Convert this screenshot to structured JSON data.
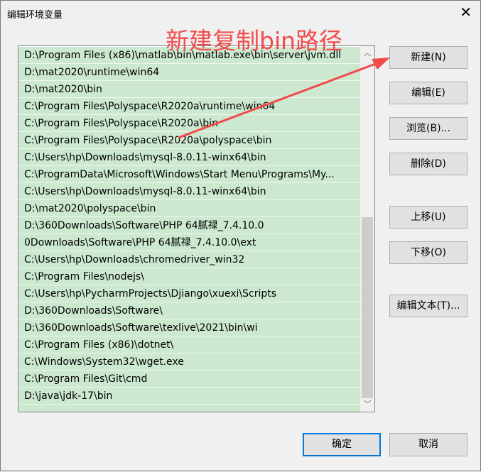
{
  "window": {
    "title": "编辑环境变量",
    "close_icon": "close-icon"
  },
  "annotation": {
    "text": "新建复制bin路径",
    "color": "#f24b4b"
  },
  "list": {
    "items": [
      "D:\\Program Files (x86)\\matlab\\bin\\matlab.exe\\bin\\server\\jvm.dll",
      "D:\\mat2020\\runtime\\win64",
      "D:\\mat2020\\bin",
      "C:\\Program Files\\Polyspace\\R2020a\\runtime\\win64",
      "C:\\Program Files\\Polyspace\\R2020a\\bin",
      "C:\\Program Files\\Polyspace\\R2020a\\polyspace\\bin",
      "C:\\Users\\hp\\Downloads\\mysql-8.0.11-winx64\\bin",
      "C:\\ProgramData\\Microsoft\\Windows\\Start Menu\\Programs\\My...",
      "C:\\Users\\hp\\Downloads\\mysql-8.0.11-winx64\\bin",
      "D:\\mat2020\\polyspace\\bin",
      "D:\\360Downloads\\Software\\PHP 64腻禄_7.4.10.0",
      "0Downloads\\Software\\PHP 64腻禄_7.4.10.0\\ext",
      "C:\\Users\\hp\\Downloads\\chromedriver_win32",
      "C:\\Program Files\\nodejs\\",
      "C:\\Users\\hp\\PycharmProjects\\Djiango\\xuexi\\Scripts",
      "D:\\360Downloads\\Software\\",
      "D:\\360Downloads\\Software\\texlive\\2021\\bin\\wi",
      "C:\\Program Files (x86)\\dotnet\\",
      "C:\\Windows\\System32\\wget.exe",
      "C:\\Program Files\\Git\\cmd",
      "D:\\java\\jdk-17\\bin",
      ""
    ],
    "row_color": "#cce8cf"
  },
  "buttons": {
    "new": "新建(N)",
    "edit": "编辑(E)",
    "browse": "浏览(B)...",
    "delete": "删除(D)",
    "up": "上移(U)",
    "down": "下移(O)",
    "edit_text": "编辑文本(T)...",
    "ok": "确定",
    "cancel": "取消"
  }
}
